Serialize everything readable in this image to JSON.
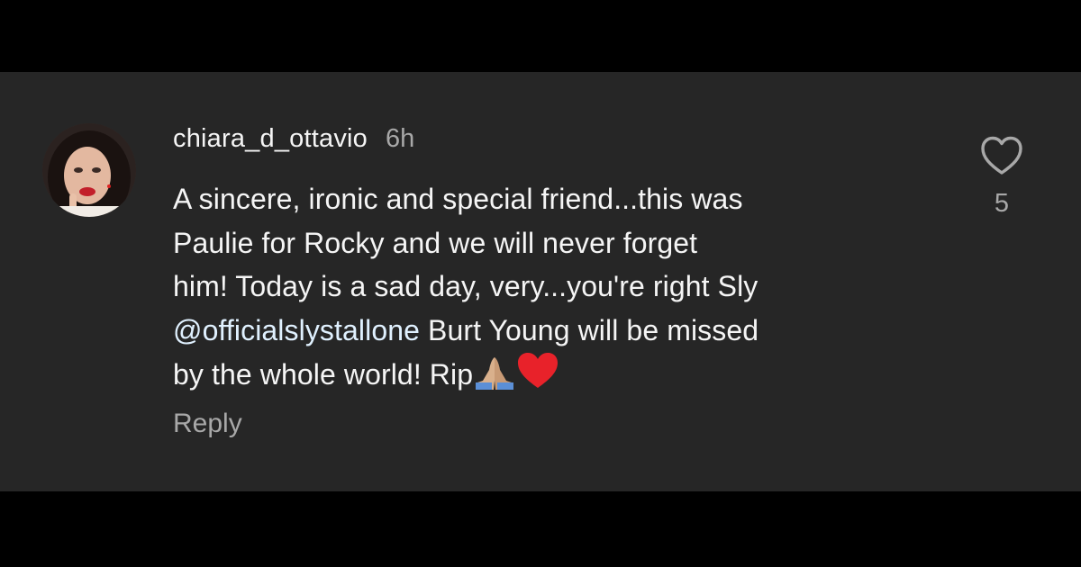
{
  "comment": {
    "username": "chiara_d_ottavio",
    "time": "6h",
    "text_line1": "A sincere, ironic and special friend...this was",
    "text_line2": "Paulie for Rocky and we will never forget",
    "text_line3": "him! Today is a sad day, very...you're right Sly",
    "mention": "@officialslystallone",
    "text_line4_rest": " Burt Young will be missed",
    "text_line5": "by the whole world! Rip",
    "emojis": [
      "folded-hands",
      "red-heart"
    ],
    "reply_label": "Reply",
    "like_count": "5"
  },
  "colors": {
    "background": "#000000",
    "panel": "#262626",
    "primary_text": "#f5f5f5",
    "secondary_text": "#a8a8a8",
    "mention": "#e0f1ff",
    "heart_emoji": "#e8222a"
  },
  "icons": {
    "like": "heart-outline-icon",
    "avatar": "user-avatar"
  }
}
